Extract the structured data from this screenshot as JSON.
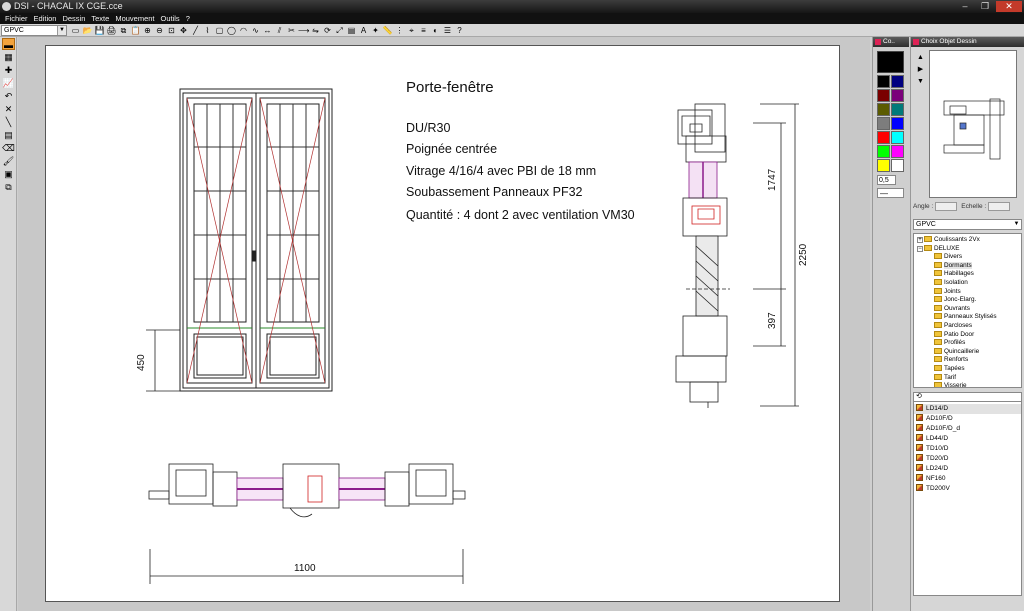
{
  "window": {
    "title": "DSI - CHACAL IX   CGE.cce",
    "controls": [
      "–",
      "❐",
      "✕"
    ]
  },
  "menu": [
    "Fichier",
    "Edition",
    "Dessin",
    "Texte",
    "Mouvement",
    "Outils",
    "?"
  ],
  "toolbar": {
    "profile_select": "GPVC",
    "tool_icons": [
      "new-icon",
      "open-icon",
      "save-icon",
      "print-icon",
      "copy-icon",
      "paste-icon",
      "zoom-in-icon",
      "zoom-out-icon",
      "zoom-window-icon",
      "pan-icon",
      "line-icon",
      "polyline-icon",
      "rectangle-icon",
      "circle-icon",
      "arc-icon",
      "curve-icon",
      "dimension-icon",
      "offset-icon",
      "trim-icon",
      "extend-icon",
      "mirror-icon",
      "rotate-icon",
      "scale-icon",
      "hatch-icon",
      "text-icon",
      "symbol-icon",
      "measure-icon",
      "grid-icon",
      "snap-icon",
      "layer-icon",
      "color-icon",
      "properties-icon",
      "help-icon"
    ],
    "tool_glyphs": [
      "▭",
      "📂",
      "💾",
      "🖨",
      "⧉",
      "📋",
      "⊕",
      "⊖",
      "⊡",
      "✥",
      "╱",
      "⌇",
      "▢",
      "◯",
      "◠",
      "∿",
      "↔",
      "⫽",
      "✂",
      "⟶",
      "⇋",
      "⟳",
      "⤢",
      "▤",
      "A",
      "✦",
      "📏",
      "⋮",
      "⌖",
      "≡",
      "◐",
      "☰",
      "?"
    ]
  },
  "left_tools": [
    {
      "name": "select-tool",
      "glyph": "▬"
    },
    {
      "name": "layer-tool",
      "glyph": "▦"
    },
    {
      "name": "add-tool",
      "glyph": "✚"
    },
    {
      "name": "chart-tool",
      "glyph": "📈"
    },
    {
      "name": "undo-tool",
      "glyph": "↶"
    },
    {
      "name": "delete-tool",
      "glyph": "✕"
    },
    {
      "name": "line-tool",
      "glyph": "╲"
    },
    {
      "name": "hatch-tool",
      "glyph": "▤"
    },
    {
      "name": "erase-tool",
      "glyph": "⌫"
    },
    {
      "name": "brush-tool",
      "glyph": "🖌"
    },
    {
      "name": "frame-tool",
      "glyph": "▣"
    },
    {
      "name": "group-tool",
      "glyph": "⧉"
    }
  ],
  "drawing": {
    "title": "Porte-fenêtre",
    "lines": [
      "DU/R30",
      "Poignée centrée",
      "Vitrage 4/16/4 avec PBI de 18 mm",
      "Soubassement Panneaux PF32"
    ],
    "quantity": "Quantité : 4 dont 2 avec ventilation VM30",
    "dim_width": "1100",
    "dim_panel": "450",
    "dim_upper": "1747",
    "dim_lower": "397",
    "dim_total": "2250"
  },
  "colors_panel": {
    "title": "Co..",
    "current": "#000000",
    "swatches": [
      "#000000",
      "#000080",
      "#7a0000",
      "#7a007a",
      "#5b5b00",
      "#007a7a",
      "#7d7d7d",
      "#0000ff",
      "#ff0000",
      "#00ffff",
      "#00ff00",
      "#ff00ff",
      "#ffff00",
      "#ffffff"
    ],
    "line_width": "0,5",
    "line_style": "—"
  },
  "object_panel": {
    "title": "Choix Objet Dessin",
    "angle_label": "Angle :",
    "scale_label": "Echelle :",
    "category_select": "GPVC",
    "tree": [
      {
        "label": "Coulissants 2Vx",
        "level": 0,
        "toggle": "+"
      },
      {
        "label": "DELUXE",
        "level": 0,
        "toggle": "−"
      },
      {
        "label": "Divers",
        "level": 1
      },
      {
        "label": "Dormants",
        "level": 1,
        "selected": true
      },
      {
        "label": "Habillages",
        "level": 1
      },
      {
        "label": "Isolation",
        "level": 1
      },
      {
        "label": "Joints",
        "level": 1
      },
      {
        "label": "Jonc-Elarg.",
        "level": 1
      },
      {
        "label": "Ouvrants",
        "level": 1
      },
      {
        "label": "Panneaux Stylisés",
        "level": 1
      },
      {
        "label": "Parcloses",
        "level": 1
      },
      {
        "label": "Patio Door",
        "level": 1
      },
      {
        "label": "Profilés",
        "level": 1
      },
      {
        "label": "Quincaillerie",
        "level": 1
      },
      {
        "label": "Renforts",
        "level": 1
      },
      {
        "label": "Tapées",
        "level": 1
      },
      {
        "label": "Tarif",
        "level": 1
      },
      {
        "label": "Visserie",
        "level": 1
      }
    ],
    "items": [
      "LD14/D",
      "AD10F/D",
      "AD10F/D_d",
      "LD44/D",
      "TD10/D",
      "TD20/D",
      "LD24/D",
      "NF160",
      "TD200V"
    ]
  }
}
